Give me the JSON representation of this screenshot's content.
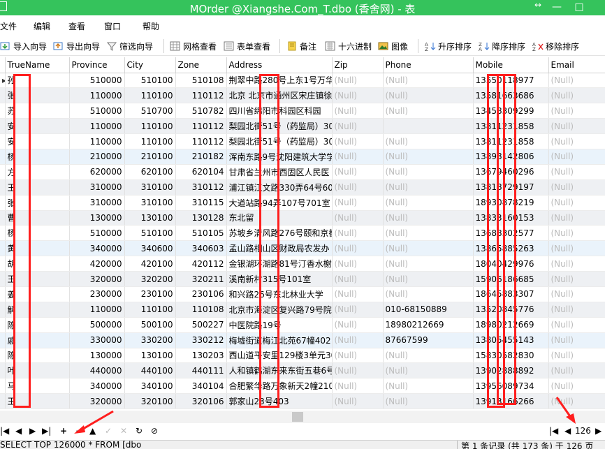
{
  "window": {
    "title": "MOrder @Xiangshe.Com_T.dbo (香舍网) - 表",
    "resize_mark": "↔",
    "minimize": "—",
    "maximize": "□"
  },
  "menu": [
    "文件",
    "编辑",
    "查看",
    "窗口",
    "帮助"
  ],
  "toolbar": {
    "import_wizard": "导入向导",
    "export_wizard": "导出向导",
    "filter_wizard": "筛选向导",
    "grid_view": "网格查看",
    "form_view": "表单查看",
    "memo": "备注",
    "hex": "十六进制",
    "image": "图像",
    "sort_asc": "升序排序",
    "sort_desc": "降序排序",
    "remove_sort": "移除排序"
  },
  "columns": [
    "TrueName",
    "Province",
    "City",
    "Zone",
    "Address",
    "Zip",
    "Phone",
    "Mobile",
    "Email"
  ],
  "rows": [
    [
      "孙",
      "510000",
      "510100",
      "510108",
      "荆翠中路280号上东1号万华",
      "(Null)",
      "(Null)",
      "13550118977",
      "(Null)"
    ],
    [
      "张",
      "110000",
      "110100",
      "110112",
      "北京 北京市通州区宋庄镇徐",
      "(Null)",
      "(Null)",
      "13581663686",
      "(Null)"
    ],
    [
      "苏",
      "510000",
      "510700",
      "510782",
      "四川省绵阳市科园区科园",
      "(Null)",
      "(Null)",
      "13458309299",
      "(Null)"
    ],
    [
      "安",
      "110000",
      "110100",
      "110112",
      "梨园北街51号（药监局）30",
      "(Null)",
      "",
      "13811231858",
      "(Null)"
    ],
    [
      "安",
      "110000",
      "110100",
      "110112",
      "梨园北街51号（药监局）30",
      "(Null)",
      "(Null)",
      "13811231858",
      "(Null)"
    ],
    [
      "杨",
      "210000",
      "210100",
      "210182",
      "浑南东路9号沈阳建筑大学学",
      "(Null)",
      "(Null)",
      "13898142806",
      "(Null)"
    ],
    [
      "方",
      "620000",
      "620100",
      "620104",
      "甘肃省兰州市西固区人民医",
      "(Null)",
      "(Null)",
      "13679460296",
      "(Null)"
    ],
    [
      "王",
      "310000",
      "310100",
      "310112",
      "浦江镇江文路330弄64号60",
      "(Null)",
      "(Null)",
      "13818729197",
      "(Null)"
    ],
    [
      "张",
      "310000",
      "310100",
      "310115",
      "大道站路94弄107号701室",
      "(Null)",
      "(Null)",
      "18930878219",
      "(Null)"
    ],
    [
      "曹",
      "130000",
      "130100",
      "130128",
      "东北留",
      "(Null)",
      "(Null)",
      "13833160153",
      "(Null)"
    ],
    [
      "杨",
      "510000",
      "510100",
      "510105",
      "苏坡乡清风路276号颐和京都",
      "(Null)",
      "(Null)",
      "13688302577",
      "(Null)"
    ],
    [
      "黄",
      "340000",
      "340600",
      "340603",
      "孟山路相山区财政局农发办",
      "(Null)",
      "(Null)",
      "13865885263",
      "(Null)"
    ],
    [
      "胡",
      "420000",
      "420100",
      "420112",
      "金银湖环湖路81号汀香水榭",
      "(Null)",
      "(Null)",
      "18040429976",
      "(Null)"
    ],
    [
      "王",
      "320000",
      "320200",
      "320211",
      "溪南新村315号101室",
      "(Null)",
      "(Null)",
      "15906186685",
      "(Null)"
    ],
    [
      "姜",
      "230000",
      "230100",
      "230106",
      "和兴路26号东北林业大学",
      "(Null)",
      "(Null)",
      "18645883307",
      "(Null)"
    ],
    [
      "解",
      "110000",
      "110100",
      "110108",
      "北京市海淀区复兴路79号院",
      "(Null)",
      "010-68150889",
      "13520845776",
      "(Null)"
    ],
    [
      "陈",
      "500000",
      "500100",
      "500227",
      "中医院路19号",
      "(Null)",
      "18980212669",
      "18980212669",
      "(Null)"
    ],
    [
      "戚",
      "330000",
      "330200",
      "330212",
      "梅墟街道梅江北苑67幢402",
      "(Null)",
      "87667599",
      "13805455143",
      "(Null)"
    ],
    [
      "陈",
      "130000",
      "130100",
      "130203",
      "西山道平安里129楼3单元30",
      "(Null)",
      "(Null)",
      "15830582830",
      "(Null)"
    ],
    [
      "叶",
      "440000",
      "440100",
      "440111",
      "人和镇鹤湖东来东街五巷6号",
      "(Null)",
      "(Null)",
      "13902888892",
      "(Null)"
    ],
    [
      "马",
      "340000",
      "340100",
      "340104",
      "合肥繁华路万象新天2幢210",
      "(Null)",
      "(Null)",
      "13956089734",
      "(Null)"
    ],
    [
      "王",
      "320000",
      "320100",
      "320106",
      "郭家山23号403",
      "(Null)",
      "(Null)",
      "13913166266",
      "(Null)"
    ]
  ],
  "nav": {
    "first": "|◀",
    "prev": "◀",
    "next": "▶",
    "last": "▶|",
    "add": "+",
    "delete": "−",
    "up": "▲",
    "apply": "✓",
    "cancel": "✕",
    "refresh": "↻",
    "stop": "⊘",
    "page_first": "|◀",
    "page_prev": "◀",
    "page_next": "▶",
    "page_number": "126"
  },
  "status": {
    "sql": "SELECT TOP 126000 * FROM [dbo",
    "records": "第 1 条记录 (共 173 条) 于 126 页"
  },
  "colors": {
    "titlebar": "#35c35c",
    "highlight": "#ff1e1e",
    "alt_row": "#eef0f3"
  }
}
